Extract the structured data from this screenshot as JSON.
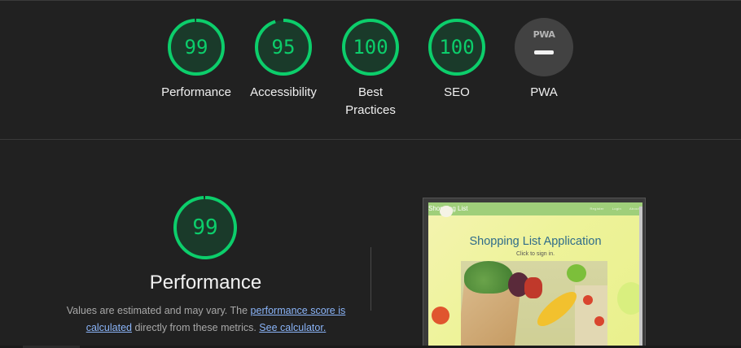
{
  "summary": {
    "gauges": [
      {
        "score": "99",
        "label": "Performance",
        "fraction": 0.99
      },
      {
        "score": "95",
        "label": "Accessibility",
        "fraction": 0.95
      },
      {
        "score": "100",
        "label": "Best Practices",
        "fraction": 1.0
      },
      {
        "score": "100",
        "label": "SEO",
        "fraction": 1.0
      }
    ],
    "pwa": {
      "badge": "PWA",
      "label": "PWA",
      "icon": "pwa-dash-icon"
    }
  },
  "performance": {
    "score": "99",
    "fraction": 0.99,
    "title": "Performance",
    "desc_pre": "Values are estimated and may vary. The ",
    "link_score": "performance score is calculated",
    "desc_mid": " directly from these metrics. ",
    "link_calc": "See calculator.",
    "status_color": "#0cce6b"
  },
  "screenshot": {
    "brand": "Shopping List",
    "nav_links": [
      "Register",
      "Login",
      "About"
    ],
    "title": "Shopping List Application",
    "subtitle": "Click to sign in."
  }
}
